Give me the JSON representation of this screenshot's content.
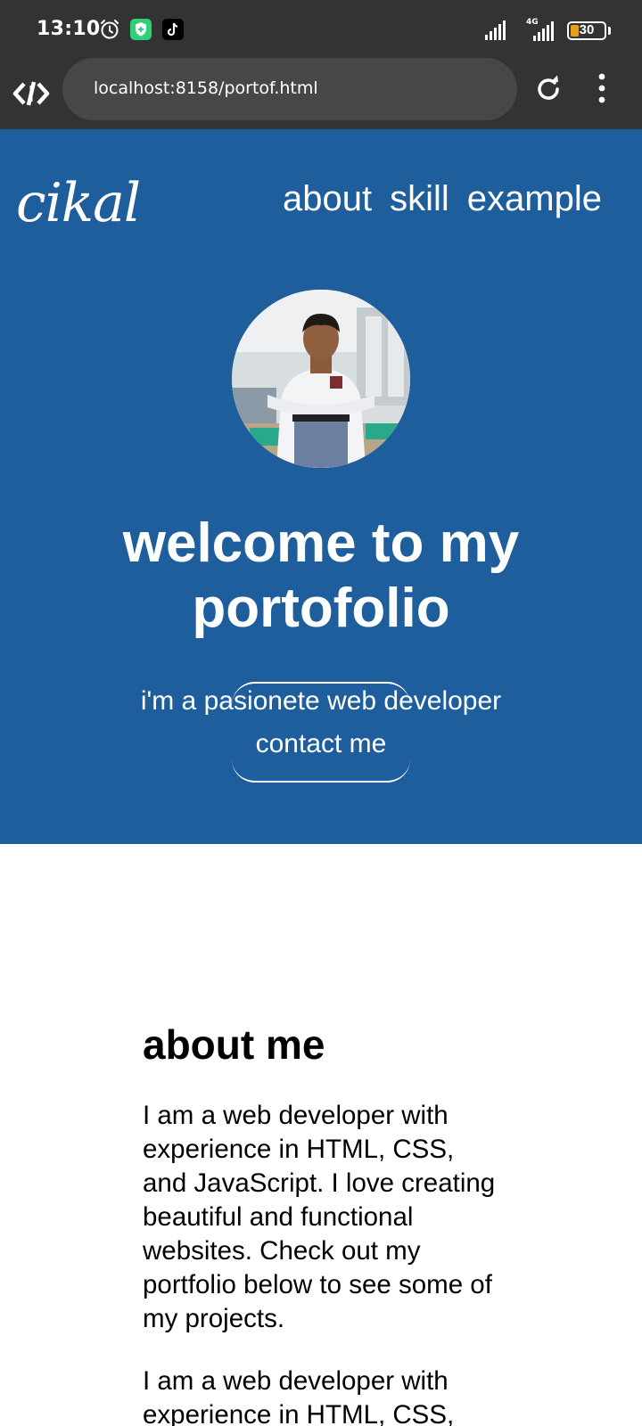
{
  "status": {
    "time": "13:10",
    "network": "4G",
    "battery": "30"
  },
  "browser": {
    "url": "localhost:8158/portof.html"
  },
  "hero": {
    "logo": "cikal",
    "nav": [
      "about",
      "skill",
      "example"
    ],
    "title_line1": "welcome to my",
    "title_line2": "portofolio",
    "subtitle": "i'm a pasionete web developer",
    "contact_label": "contact me"
  },
  "about": {
    "heading": "about me",
    "paragraph1": "I am a web developer with experience in HTML, CSS, and JavaScript. I love creating beautiful and functional websites. Check out my portfolio below to see some of my projects.",
    "paragraph2": "I am a web developer with experience in HTML, CSS,"
  },
  "colors": {
    "hero_bg": "#1f5e9c",
    "system_bar": "#333333",
    "url_box": "#474747"
  }
}
